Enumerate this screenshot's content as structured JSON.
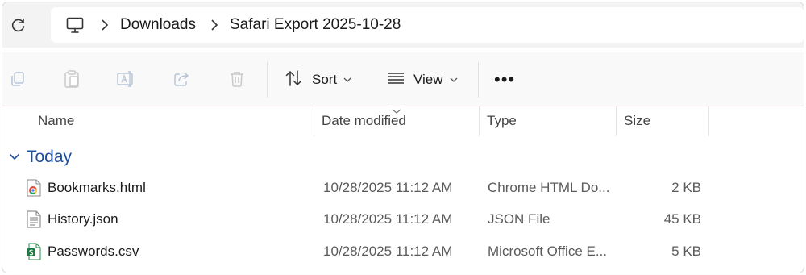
{
  "address_bar": {
    "breadcrumbs": [
      "Downloads",
      "Safari Export 2025-10-28"
    ]
  },
  "command_bar": {
    "sort_label": "Sort",
    "view_label": "View",
    "more_label": "•••"
  },
  "columns": {
    "name": "Name",
    "date": "Date modified",
    "type": "Type",
    "size": "Size"
  },
  "group": {
    "label": "Today"
  },
  "files": [
    {
      "name": "Bookmarks.html",
      "date": "10/28/2025 11:12 AM",
      "type": "Chrome HTML Do...",
      "size": "2 KB",
      "icon": "chrome-html-icon"
    },
    {
      "name": "History.json",
      "date": "10/28/2025 11:12 AM",
      "type": "JSON File",
      "size": "45 KB",
      "icon": "text-file-icon"
    },
    {
      "name": "Passwords.csv",
      "date": "10/28/2025 11:12 AM",
      "type": "Microsoft Office E...",
      "size": "5 KB",
      "icon": "excel-csv-icon"
    }
  ],
  "colors": {
    "accent_text": "#1f4e9c",
    "toolbar_bg": "#f9f9f9",
    "addr_bg": "#f3f3f3"
  }
}
